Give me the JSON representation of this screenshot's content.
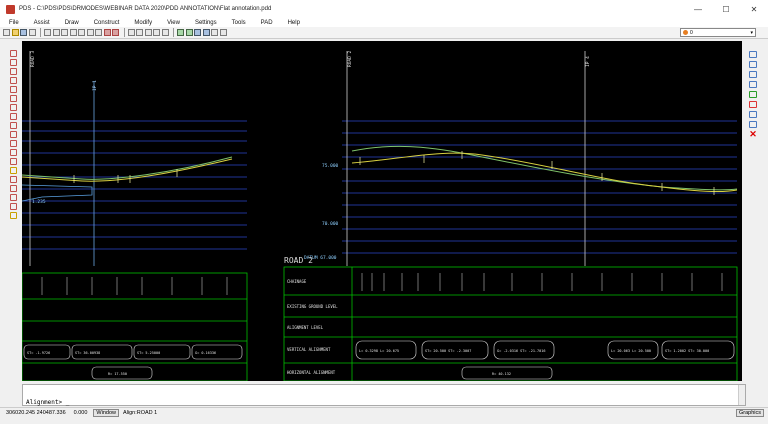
{
  "window": {
    "title": "PDS - C:\\PDS\\PDS\\DRMODES\\WEBINAR DATA 2020\\PDD ANNOTATION\\Flat annotation.pdd",
    "min_glyph": "—",
    "max_glyph": "☐",
    "close_glyph": "✕"
  },
  "menu": [
    "File",
    "Assist",
    "Draw",
    "Construct",
    "Modify",
    "View",
    "Settings",
    "Tools",
    "PAD",
    "Help"
  ],
  "layer_selector": {
    "value": "0"
  },
  "canvas": {
    "left_road_label": "ROAD 3",
    "left_ip_label": "IP 1",
    "mid_road_label": "ROAD 2",
    "right_ip_label": "IP 4",
    "datum_left": "DATUM",
    "datum_value": "0.000",
    "level_upper": "75.000",
    "level_lower": "70.000",
    "datum_right": "DATUM  67.000",
    "small_level": "1.235",
    "road_title": "ROAD 2",
    "rows": [
      "CHAINAGE",
      "EXISTING GROUND LEVEL",
      "ALIGNMENT LEVEL",
      "VERTICAL ALIGNMENT",
      "HORIZONTAL ALIGNMENT"
    ],
    "vc_labels_right": [
      "L= 0.3298  L= 20.675",
      "ST= 20.500  ST= -2.3007",
      "G= -2.0316  ST= -21.7016",
      "L= 20.063  L= 20.500",
      "ST= 1.2002  ST= 30.000"
    ],
    "vc_labels_left": [
      "ST= -1.9726",
      "ST= 36.00938",
      "ST= 5.25000",
      "G= 0.16336"
    ],
    "hz_label_left": "R= 17.550",
    "hz_label_right": "R= 40.132"
  },
  "command": {
    "prompt": "Alignment> _"
  },
  "status": {
    "coords": "306020.245  240487.336",
    "extra": "0.000",
    "window_btn": "Window",
    "align_label": "Align:ROAD 1",
    "graphics_btn": "Graphics"
  }
}
